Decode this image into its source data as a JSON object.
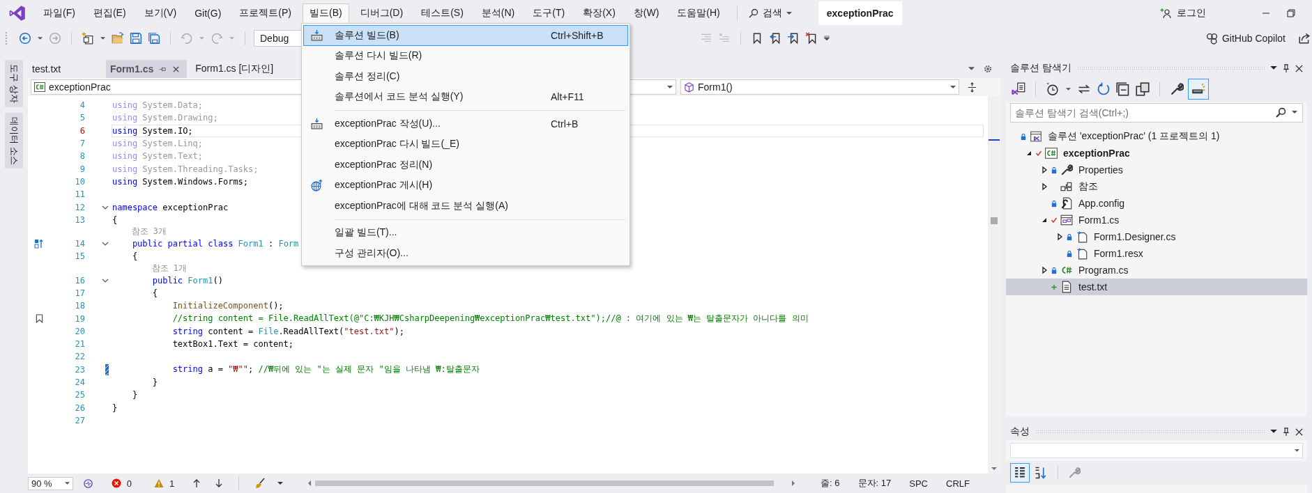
{
  "window": {
    "title": "exceptionPrac",
    "search_label": "검색",
    "login": "로그인",
    "copilot": "GitHub Copilot"
  },
  "menu": [
    {
      "label": "파일(F)",
      "selected": false
    },
    {
      "label": "편집(E)",
      "selected": false
    },
    {
      "label": "보기(V)",
      "selected": false
    },
    {
      "label": "Git(G)",
      "selected": false
    },
    {
      "label": "프로젝트(P)",
      "selected": false
    },
    {
      "label": "빌드(B)",
      "selected": true
    },
    {
      "label": "디버그(D)",
      "selected": false
    },
    {
      "label": "테스트(S)",
      "selected": false
    },
    {
      "label": "분석(N)",
      "selected": false
    },
    {
      "label": "도구(T)",
      "selected": false
    },
    {
      "label": "확장(X)",
      "selected": false
    },
    {
      "label": "창(W)",
      "selected": false
    },
    {
      "label": "도움말(H)",
      "selected": false
    }
  ],
  "toolbar": {
    "configuration": "Debug"
  },
  "build_menu": [
    {
      "kind": "build",
      "label": "솔루션 빌드(B)",
      "shortcut": "Ctrl+Shift+B",
      "selected": true
    },
    {
      "kind": "plain",
      "label": "솔루션 다시 빌드(R)",
      "selected": false
    },
    {
      "kind": "plain",
      "label": "솔루션 정리(C)",
      "selected": false
    },
    {
      "kind": "plain",
      "label": "솔루션에서 코드 분석 실행(Y)",
      "shortcut": "Alt+F11",
      "selected": false
    },
    {
      "kind": "separator"
    },
    {
      "kind": "build",
      "label": "exceptionPrac 작성(U)...",
      "shortcut": "Ctrl+B",
      "selected": false
    },
    {
      "kind": "plain",
      "label": "exceptionPrac 다시 빌드(_E)",
      "selected": false
    },
    {
      "kind": "plain",
      "label": "exceptionPrac 정리(N)",
      "selected": false
    },
    {
      "kind": "publish",
      "label": "exceptionPrac 게시(H)",
      "selected": false
    },
    {
      "kind": "plain",
      "label": "exceptionPrac에 대해 코드 분석 실행(A)",
      "selected": false
    },
    {
      "kind": "separator"
    },
    {
      "kind": "plain",
      "label": "일괄 빌드(T)...",
      "selected": false
    },
    {
      "kind": "plain",
      "label": "구성 관리자(O)...",
      "selected": false
    }
  ],
  "side_tabs": [
    "도구 상자",
    "데이터 소스"
  ],
  "tabs": [
    {
      "label": "test.txt",
      "selected": false
    },
    {
      "label": "Form1.cs",
      "selected": true
    },
    {
      "label": "Form1.cs [디자인]",
      "selected": false
    }
  ],
  "navigation": {
    "project": "exceptionPrac",
    "member": "Form1()"
  },
  "code": [
    {
      "kind": "code",
      "number": "4",
      "current": false,
      "fold": false,
      "tokens": [
        {
          "kind": "kwdim",
          "text": "using"
        },
        {
          "kind": "dim",
          "text": " System.Data;"
        }
      ]
    },
    {
      "kind": "code",
      "number": "5",
      "current": false,
      "fold": false,
      "tokens": [
        {
          "kind": "kwdim",
          "text": "using"
        },
        {
          "kind": "dim",
          "text": " System.Drawing;"
        }
      ]
    },
    {
      "kind": "code",
      "number": "6",
      "current": true,
      "fold": false,
      "tokens": [
        {
          "kind": "kw",
          "text": "using"
        },
        {
          "kind": "plain",
          "text": " System.IO;"
        }
      ]
    },
    {
      "kind": "code",
      "number": "7",
      "current": false,
      "fold": false,
      "tokens": [
        {
          "kind": "kwdim",
          "text": "using"
        },
        {
          "kind": "dim",
          "text": " System.Linq;"
        }
      ]
    },
    {
      "kind": "code",
      "number": "8",
      "current": false,
      "fold": false,
      "tokens": [
        {
          "kind": "kwdim",
          "text": "using"
        },
        {
          "kind": "dim",
          "text": " System.Text;"
        }
      ]
    },
    {
      "kind": "code",
      "number": "9",
      "current": false,
      "fold": false,
      "tokens": [
        {
          "kind": "kwdim",
          "text": "using"
        },
        {
          "kind": "dim",
          "text": " System.Threading.Tasks;"
        }
      ]
    },
    {
      "kind": "code",
      "number": "10",
      "current": false,
      "fold": false,
      "tokens": [
        {
          "kind": "kw",
          "text": "using"
        },
        {
          "kind": "plain",
          "text": " System.Windows.Forms;"
        }
      ]
    },
    {
      "kind": "code",
      "number": "11",
      "current": false,
      "fold": false
    },
    {
      "kind": "code",
      "number": "12",
      "current": false,
      "fold": true,
      "tokens": [
        {
          "kind": "kw",
          "text": "namespace"
        },
        {
          "kind": "plain",
          "text": " exceptionPrac"
        }
      ]
    },
    {
      "kind": "code",
      "number": "13",
      "current": false,
      "fold": false,
      "tokens": [
        {
          "kind": "plain",
          "text": "{"
        }
      ]
    },
    {
      "kind": "codelens",
      "text": "    참조 3개"
    },
    {
      "kind": "override",
      "number": "14",
      "current": false,
      "fold": true,
      "tokens": [
        {
          "kind": "kw",
          "text": "    public partial class "
        },
        {
          "kind": "type",
          "text": "Form1"
        },
        {
          "kind": "plain",
          "text": " : "
        },
        {
          "kind": "type",
          "text": "Form"
        }
      ]
    },
    {
      "kind": "code",
      "number": "15",
      "current": false,
      "fold": false,
      "tokens": [
        {
          "kind": "plain",
          "text": "    {"
        }
      ]
    },
    {
      "kind": "codelens",
      "text": "        참조 1개"
    },
    {
      "kind": "code",
      "number": "16",
      "current": false,
      "fold": true,
      "tokens": [
        {
          "kind": "kw",
          "text": "        public "
        },
        {
          "kind": "type",
          "text": "Form1"
        },
        {
          "kind": "plain",
          "text": "()"
        }
      ]
    },
    {
      "kind": "code",
      "number": "17",
      "current": false,
      "fold": false,
      "tokens": [
        {
          "kind": "plain",
          "text": "        {"
        }
      ]
    },
    {
      "kind": "code",
      "number": "18",
      "current": false,
      "fold": false,
      "tokens": [
        {
          "kind": "method",
          "text": "            InitializeComponent"
        },
        {
          "kind": "plain",
          "text": "();"
        }
      ]
    },
    {
      "kind": "bookmark",
      "number": "19",
      "current": false,
      "fold": false,
      "tokens": [
        {
          "kind": "com",
          "text": "            //string content = File.ReadAllText(@\"C:₩KJH₩CsharpDeepening₩exceptionPrac₩test.txt\");//@ : 여기에 있는 ₩는 탈출문자가 아니다를 의미"
        }
      ]
    },
    {
      "kind": "code",
      "number": "20",
      "current": false,
      "fold": false,
      "tokens": [
        {
          "kind": "kw",
          "text": "            string"
        },
        {
          "kind": "plain",
          "text": " content = "
        },
        {
          "kind": "type",
          "text": "File"
        },
        {
          "kind": "plain",
          "text": ".ReadAllText("
        },
        {
          "kind": "str",
          "text": "\"test.txt\""
        },
        {
          "kind": "plain",
          "text": ");"
        }
      ]
    },
    {
      "kind": "code",
      "number": "21",
      "current": false,
      "fold": false,
      "tokens": [
        {
          "kind": "plain",
          "text": "            textBox1.Text = content;"
        }
      ]
    },
    {
      "kind": "code",
      "number": "22",
      "current": false,
      "fold": false
    },
    {
      "kind": "change",
      "number": "23",
      "current": false,
      "fold": false,
      "tokens": [
        {
          "kind": "kw",
          "text": "            string"
        },
        {
          "kind": "plain",
          "text": " a = "
        },
        {
          "kind": "str",
          "text": "\"₩\"\""
        },
        {
          "kind": "plain",
          "text": "; "
        },
        {
          "kind": "com",
          "text": "//₩뒤에 있는 \"는 실제 문자 \"임을 나타냄 ₩:탈출문자"
        }
      ]
    },
    {
      "kind": "code",
      "number": "24",
      "current": false,
      "fold": false,
      "tokens": [
        {
          "kind": "plain",
          "text": "        }"
        }
      ]
    },
    {
      "kind": "code",
      "number": "25",
      "current": false,
      "fold": false,
      "tokens": [
        {
          "kind": "plain",
          "text": "    }"
        }
      ]
    },
    {
      "kind": "code",
      "number": "26",
      "current": false,
      "fold": false,
      "tokens": [
        {
          "kind": "plain",
          "text": "}"
        }
      ]
    },
    {
      "kind": "code",
      "number": "27",
      "current": false,
      "fold": false
    }
  ],
  "editor_status": {
    "zoom": "90 %",
    "errors": "0",
    "warnings": "1",
    "line": "줄: 6",
    "column": "문자: 17",
    "whitespace": "SPC",
    "line_ending": "CRLF"
  },
  "solution_explorer": {
    "title": "솔루션 탐색기",
    "search": {
      "placeholder": "솔루션 탐색기 검색(Ctrl+;)"
    },
    "tree": [
      {
        "label": "솔루션 'exceptionPrac' (1 프로젝트의 1)",
        "kind": "solution",
        "locked": true,
        "modified": false,
        "added": false,
        "expandable": false,
        "selected": false,
        "children": [
          {
            "label": "exceptionPrac",
            "kind": "project",
            "locked": false,
            "modified": true,
            "added": false,
            "expandable": true,
            "expanded": true,
            "selected": false,
            "children": [
              {
                "label": "Properties",
                "kind": "wrench",
                "locked": true,
                "modified": false,
                "added": false,
                "expandable": true,
                "expanded": false,
                "selected": false
              },
              {
                "label": "참조",
                "kind": "references",
                "locked": false,
                "modified": false,
                "added": false,
                "expandable": true,
                "expanded": false,
                "selected": false
              },
              {
                "label": "App.config",
                "kind": "config",
                "locked": true,
                "modified": false,
                "added": false,
                "expandable": false,
                "selected": false
              },
              {
                "label": "Form1.cs",
                "kind": "form",
                "locked": false,
                "modified": true,
                "added": false,
                "expandable": true,
                "expanded": true,
                "selected": false,
                "children": [
                  {
                    "label": "Form1.Designer.cs",
                    "kind": "file",
                    "locked": true,
                    "modified": false,
                    "added": false,
                    "expandable": true,
                    "expanded": false,
                    "selected": false
                  },
                  {
                    "label": "Form1.resx",
                    "kind": "file",
                    "locked": true,
                    "modified": false,
                    "added": false,
                    "expandable": false,
                    "selected": false
                  }
                ]
              },
              {
                "label": "Program.cs",
                "kind": "csharp",
                "locked": true,
                "modified": false,
                "added": false,
                "expandable": true,
                "expanded": false,
                "selected": false
              },
              {
                "label": "test.txt",
                "kind": "text",
                "locked": false,
                "modified": false,
                "added": true,
                "expandable": false,
                "selected": true
              }
            ]
          }
        ]
      }
    ]
  },
  "properties": {
    "title": "속성"
  }
}
